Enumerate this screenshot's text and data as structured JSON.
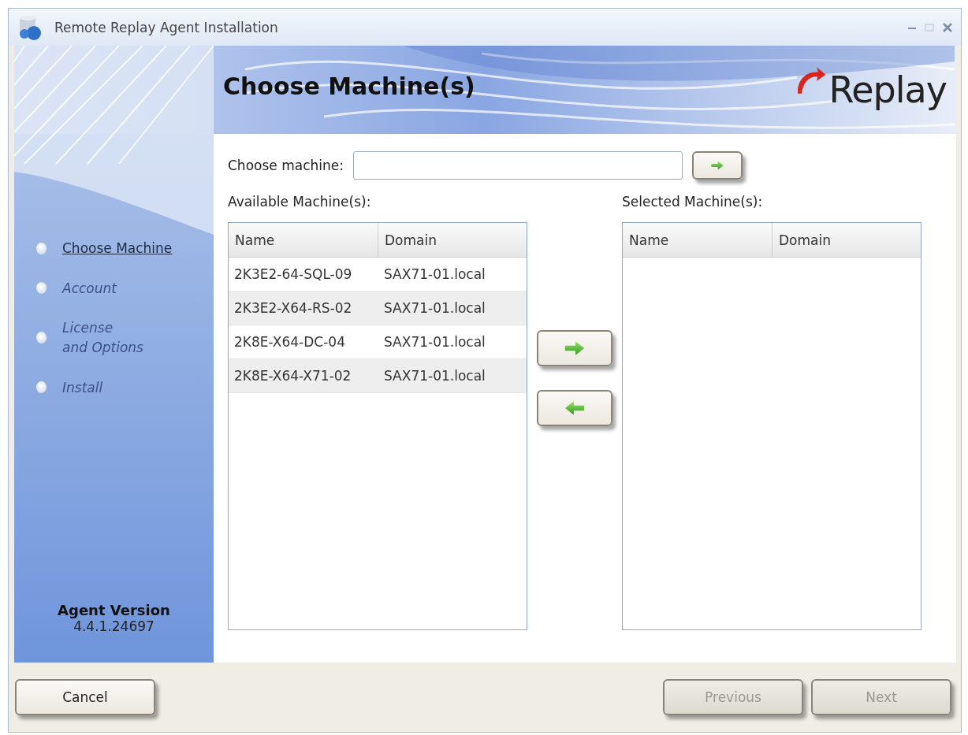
{
  "window": {
    "title": "Remote Replay Agent Installation"
  },
  "header": {
    "title": "Choose Machine(s)",
    "logo": "Replay"
  },
  "steps": [
    {
      "label": "Choose Machine",
      "selected": true
    },
    {
      "label": "Account",
      "selected": false
    },
    {
      "label": "License\nand Options",
      "selected": false
    },
    {
      "label": "Install",
      "selected": false
    }
  ],
  "version": {
    "label": "Agent Version",
    "number": "4.4.1.24697"
  },
  "choose_machine": {
    "label": "Choose machine:"
  },
  "available": {
    "title": "Available Machine(s):",
    "columns": [
      "Name",
      "Domain"
    ],
    "rows": [
      [
        "2K3E2-64-SQL-09",
        "SAX71-01.local"
      ],
      [
        "2K3E2-X64-RS-02",
        "SAX71-01.local"
      ],
      [
        "2K8E-X64-DC-04",
        "SAX71-01.local"
      ],
      [
        "2K8E-X64-X71-02",
        "SAX71-01.local"
      ]
    ]
  },
  "selected_list": {
    "title": "Selected Machine(s):",
    "columns": [
      "Name",
      "Domain"
    ]
  },
  "buttons": [
    {
      "label": "Cancel",
      "disabled": false
    },
    {
      "label": "Previous",
      "disabled": true
    },
    {
      "label": "Next",
      "disabled": true
    }
  ]
}
